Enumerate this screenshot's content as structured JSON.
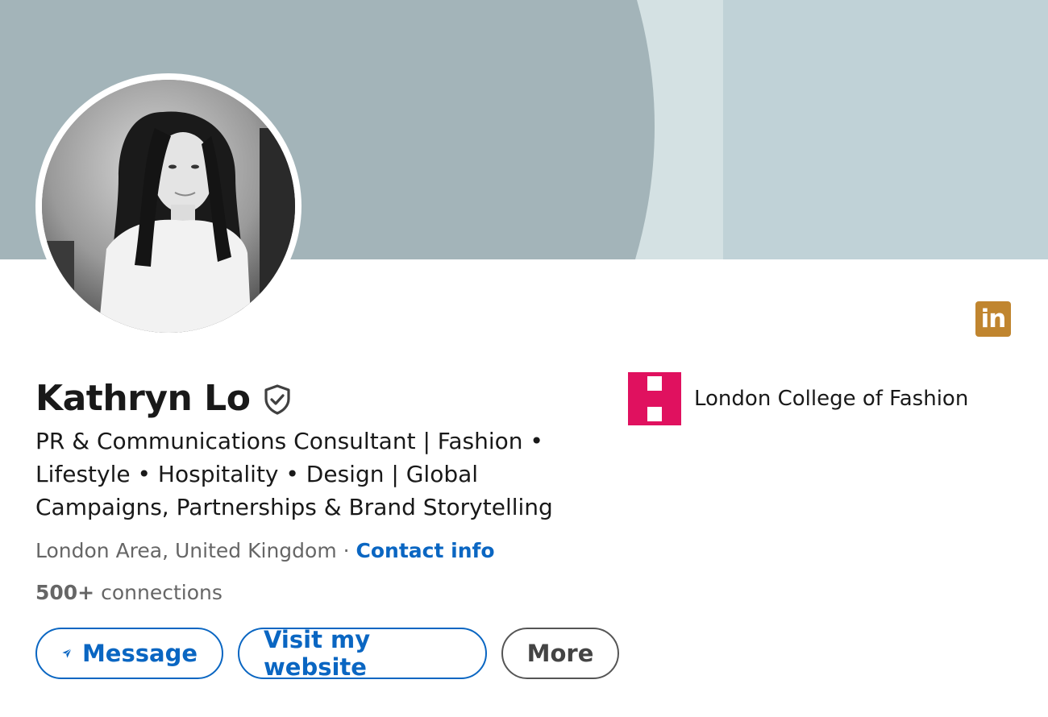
{
  "banner": {
    "colors": {
      "left": "#a3b4b9",
      "middle": "#d4e1e3",
      "right": "#c0d2d7"
    }
  },
  "profile": {
    "name": "Kathryn Lo",
    "headline": "PR & Communications Consultant | Fashion • Lifestyle • Hospitality • Design | Global Campaigns, Partnerships & Brand Storytelling",
    "location": "London Area, United Kingdom",
    "separator": " · ",
    "contact_link": "Contact info",
    "connections_count": "500+",
    "connections_label": " connections",
    "verified_icon": "verified-shield-icon"
  },
  "actions": {
    "message_label": "Message",
    "website_label": "Visit my website",
    "more_label": "More"
  },
  "education": {
    "name": "London College of Fashion",
    "logo_color": "#e0115f"
  },
  "badge": {
    "text": "in",
    "color": "#c0852f"
  },
  "colors": {
    "link": "#0a66c2",
    "text": "#191919",
    "muted": "#666666"
  }
}
